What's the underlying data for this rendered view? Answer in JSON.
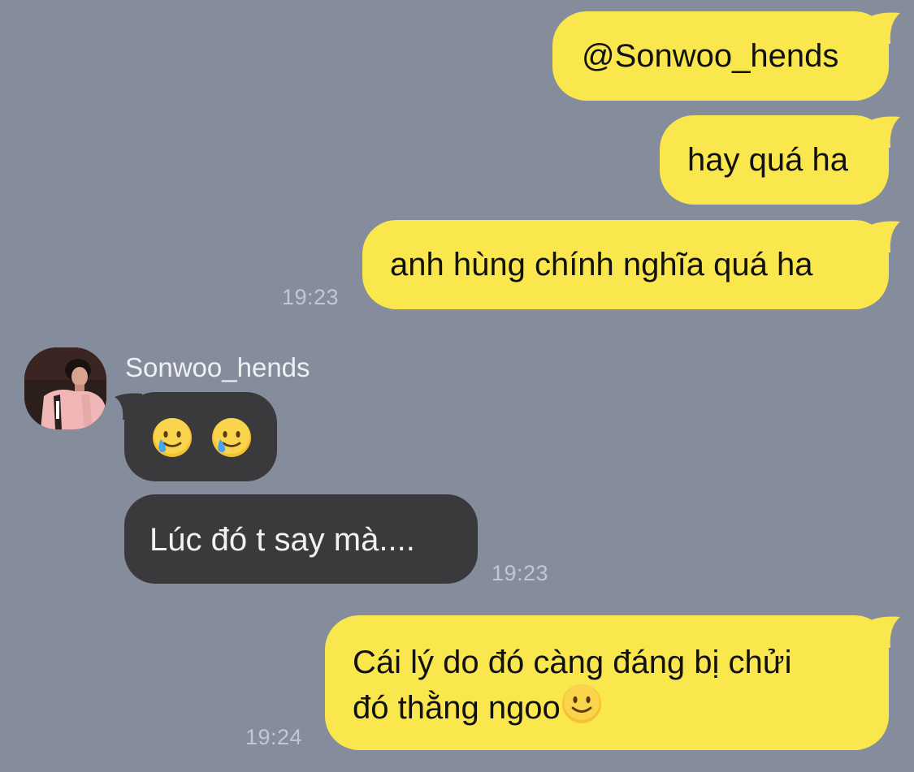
{
  "messages": [
    {
      "direction": "outgoing",
      "text": "@Sonwoo_hends"
    },
    {
      "direction": "outgoing",
      "text": "hay quá ha"
    },
    {
      "direction": "outgoing",
      "text": "anh hùng chính nghĩa quá ha",
      "time": "19:23"
    },
    {
      "direction": "incoming",
      "sender": "Sonwoo_hends",
      "emoji": [
        "crying-smile-emoji",
        "crying-smile-emoji"
      ]
    },
    {
      "direction": "incoming",
      "text": "Lúc đó t say mà....",
      "time": "19:23"
    },
    {
      "direction": "outgoing",
      "lines": [
        "Cái lý do đó càng đáng bị chửi",
        "đó thằng ngoo"
      ],
      "emoji": "slightly-smiling-emoji",
      "time": "19:24"
    }
  ],
  "colors": {
    "background": "#858c9b",
    "outgoing_bubble": "#fae74e",
    "incoming_bubble": "#3a3a3d",
    "timestamp": "#c3c7d0"
  }
}
